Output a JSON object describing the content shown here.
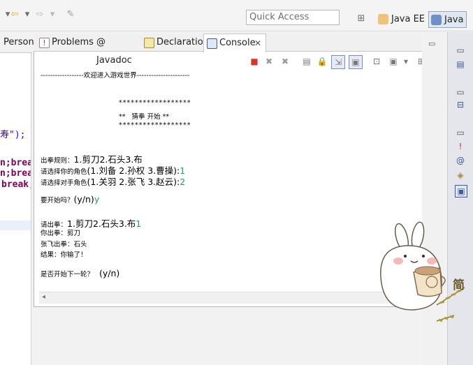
{
  "toolbar": {
    "quick_access_placeholder": "Quick Access"
  },
  "perspectives": [
    {
      "label": "Java EE"
    },
    {
      "label": "Java",
      "active": true
    }
  ],
  "editor": {
    "tab_label": "Person",
    "code_lines": [
      {
        "prefix": "",
        "string": "寿\");",
        "keyword": ""
      },
      {
        "prefix": "",
        "string": "",
        "keyword": "n;break"
      },
      {
        "prefix": "",
        "string": "",
        "keyword": "n;break"
      },
      {
        "prefix": "",
        "string": "",
        "keyword": "break;"
      }
    ]
  },
  "view_tabs": [
    {
      "label": "Problems",
      "icon": "problems-icon"
    },
    {
      "label": "@ Javadoc",
      "icon": "javadoc-icon"
    },
    {
      "label": "Declaration",
      "icon": "declaration-icon"
    },
    {
      "label": "Console",
      "icon": "console-icon",
      "active": true
    }
  ],
  "console": {
    "header": "------------------欢迎进入游戏世界----------------------",
    "banner": [
      "******************",
      "**   猜拳 开始 **",
      "******************"
    ],
    "rules": {
      "text": "出拳规则：",
      "options": "1.剪刀2.石头3.布"
    },
    "choose_role": {
      "text": "请选择你的角色",
      "options": "(1.刘备 2.孙权 3.曹操):",
      "input": "1"
    },
    "choose_opponent": {
      "text": "请选择对手角色",
      "options": "(1.关羽 2.张飞 3.赵云):",
      "input": "2"
    },
    "start_prompt": {
      "text": "要开始吗？",
      "yn": "(y/n)",
      "input": "y"
    },
    "punch_prompt": {
      "text": "请出拳：",
      "options": "1.剪刀2.石头3.布",
      "input": "1"
    },
    "you_punch": "你出拳：剪刀",
    "opponent_punch": "张飞出拳：石头",
    "result": "结果：你输了！",
    "next_prompt": {
      "text": "是否开始下一轮？",
      "yn": "  (y/n)"
    }
  },
  "sticker_text": "简",
  "colors": {
    "accent": "#3d5a99",
    "terminate": "#d9342b",
    "input_text": "#19a45a",
    "keyword": "#7f0055"
  }
}
